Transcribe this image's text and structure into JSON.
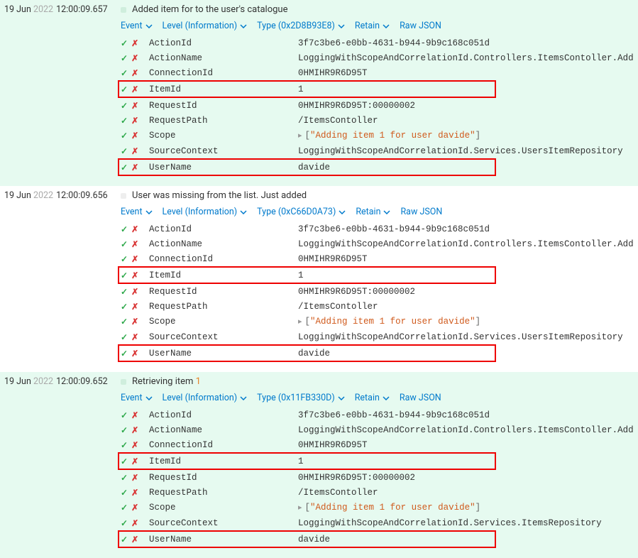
{
  "toolbar": {
    "event": "Event",
    "level_prefix": "Level",
    "level_value": "(Information)",
    "type_prefix": "Type",
    "retain": "Retain",
    "raw_json": "Raw JSON"
  },
  "entries": [
    {
      "date_day": "19 Jun",
      "date_year": "2022",
      "time": "12:00:09.657",
      "message_plain": "Added item for to the user's catalogue",
      "message_parts": [
        {
          "t": "Added item for to the user's catalogue",
          "hl": false
        }
      ],
      "type_hex": "(0x2D8B93E8)",
      "props": [
        {
          "k": "ActionId",
          "v": "3f7c3be6-e0bb-4631-b944-9b9c168c051d",
          "box": false
        },
        {
          "k": "ActionName",
          "v": "LoggingWithScopeAndCorrelationId.Controllers.ItemsContoller.Add",
          "box": false
        },
        {
          "k": "ConnectionId",
          "v": "0HMIHR9R6D95T",
          "box": false
        },
        {
          "k": "ItemId",
          "v": "1",
          "box": true
        },
        {
          "k": "RequestId",
          "v": "0HMIHR9R6D95T:00000002",
          "box": false
        },
        {
          "k": "RequestPath",
          "v": "/ItemsContoller",
          "box": false
        },
        {
          "k": "Scope",
          "scope": "Adding item 1 for user davide",
          "box": false
        },
        {
          "k": "SourceContext",
          "v": "LoggingWithScopeAndCorrelationId.Services.UsersItemRepository",
          "box": false
        },
        {
          "k": "UserName",
          "v": "davide",
          "box": true
        }
      ]
    },
    {
      "date_day": "19 Jun",
      "date_year": "2022",
      "time": "12:00:09.656",
      "message_plain": "User was missing from the list. Just added",
      "message_parts": [
        {
          "t": "User was missing from the list. Just added",
          "hl": false
        }
      ],
      "type_hex": "(0xC66D0A73)",
      "props": [
        {
          "k": "ActionId",
          "v": "3f7c3be6-e0bb-4631-b944-9b9c168c051d",
          "box": false
        },
        {
          "k": "ActionName",
          "v": "LoggingWithScopeAndCorrelationId.Controllers.ItemsContoller.Add",
          "box": false
        },
        {
          "k": "ConnectionId",
          "v": "0HMIHR9R6D95T",
          "box": false
        },
        {
          "k": "ItemId",
          "v": "1",
          "box": true
        },
        {
          "k": "RequestId",
          "v": "0HMIHR9R6D95T:00000002",
          "box": false
        },
        {
          "k": "RequestPath",
          "v": "/ItemsContoller",
          "box": false
        },
        {
          "k": "Scope",
          "scope": "Adding item 1 for user davide",
          "box": false
        },
        {
          "k": "SourceContext",
          "v": "LoggingWithScopeAndCorrelationId.Services.UsersItemRepository",
          "box": false
        },
        {
          "k": "UserName",
          "v": "davide",
          "box": true
        }
      ]
    },
    {
      "date_day": "19 Jun",
      "date_year": "2022",
      "time": "12:00:09.652",
      "message_plain": "Retrieving item 1",
      "message_parts": [
        {
          "t": "Retrieving item ",
          "hl": false
        },
        {
          "t": "1",
          "hl": true
        }
      ],
      "type_hex": "(0x11FB330D)",
      "props": [
        {
          "k": "ActionId",
          "v": "3f7c3be6-e0bb-4631-b944-9b9c168c051d",
          "box": false
        },
        {
          "k": "ActionName",
          "v": "LoggingWithScopeAndCorrelationId.Controllers.ItemsContoller.Add",
          "box": false
        },
        {
          "k": "ConnectionId",
          "v": "0HMIHR9R6D95T",
          "box": false
        },
        {
          "k": "ItemId",
          "v": "1",
          "box": true
        },
        {
          "k": "RequestId",
          "v": "0HMIHR9R6D95T:00000002",
          "box": false
        },
        {
          "k": "RequestPath",
          "v": "/ItemsContoller",
          "box": false
        },
        {
          "k": "Scope",
          "scope": "Adding item 1 for user davide",
          "box": false
        },
        {
          "k": "SourceContext",
          "v": "LoggingWithScopeAndCorrelationId.Services.ItemsRepository",
          "box": false
        },
        {
          "k": "UserName",
          "v": "davide",
          "box": true
        }
      ]
    }
  ]
}
